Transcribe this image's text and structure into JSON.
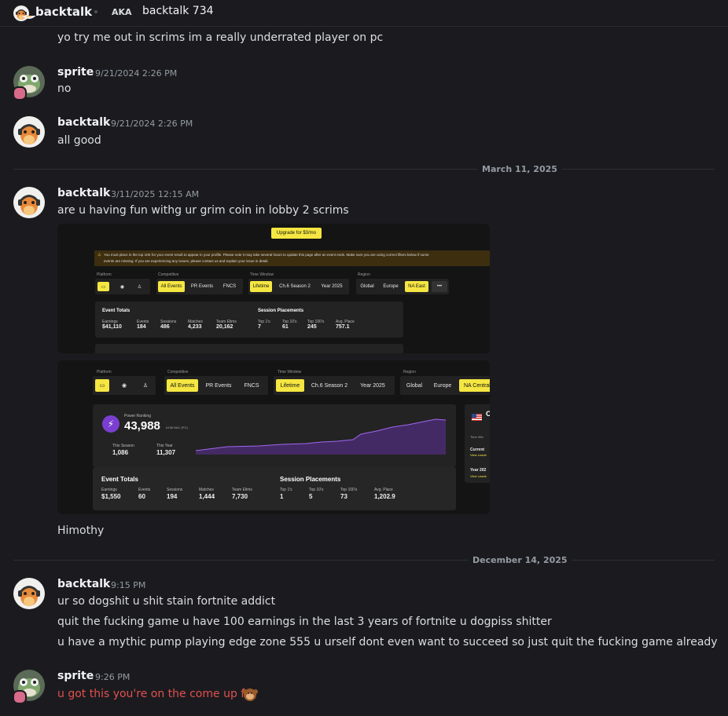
{
  "header": {
    "name": "backtalk",
    "aka_label": "AKA",
    "alias": "backtalk 734"
  },
  "messages": [
    {
      "text": "yo try me out in scrims im a really underrated player on pc"
    },
    {
      "author": "sprite",
      "time": "9/21/2024 2:26 PM",
      "text": "no"
    },
    {
      "author": "backtalk",
      "time": "9/21/2024 2:26 PM",
      "text": "all good"
    },
    {
      "author": "backtalk",
      "time": "3/11/2025 12:15 AM",
      "text": "are u having fun withg ur grim coin in lobby 2 scrims",
      "after_images": "Himothy"
    },
    {
      "author": "backtalk",
      "time": "9:15 PM",
      "lines": [
        "ur so dogshit u shit stain fortnite addict",
        "quit the fucking game u have 100 earnings in the last 3 years of fortnite u dogpiss shitter",
        "u have a mythic pump playing edge zone 555 u urself dont even want to succeed so just quit the fucking game already"
      ]
    },
    {
      "author": "sprite",
      "time": "9:26 PM",
      "text": "u got this you're on the come up fr",
      "emoji": "monkey-emoji",
      "text_color": "#e0504f"
    }
  ],
  "dividers": [
    "March 11, 2025",
    "December 14, 2025"
  ],
  "shot1": {
    "upgrade": "Upgrade for $3/mo",
    "warning": "You must place in the top 10K for your event result to appear in your profile. Please note it may take several hours to update this page after an event ends. Make sure you are using correct filters below if some",
    "warning2": "events are missing. If you are experiencing any issues, please contact us and explain your issue in detail.",
    "labels": {
      "platform": "Platform",
      "competitive": "Competitive",
      "time_window": "Time Window",
      "region": "Region"
    },
    "competitive": [
      "All Events",
      "PR Events",
      "FNCS"
    ],
    "time": [
      "Lifetime",
      "Ch.6 Season 2",
      "Year 2025"
    ],
    "region": [
      "Global",
      "Europe",
      "NA East",
      "•••"
    ],
    "event_totals": "Event Totals",
    "session_placements": "Session Placements",
    "stats": [
      {
        "label": "Earnings",
        "value": "$41,110"
      },
      {
        "label": "Events",
        "value": "184"
      },
      {
        "label": "Sessions",
        "value": "486"
      },
      {
        "label": "Matches",
        "value": "4,233"
      },
      {
        "label": "Team Elims",
        "value": "20,162"
      }
    ],
    "placements": [
      {
        "label": "Top 1's",
        "value": "7"
      },
      {
        "label": "Top 10's",
        "value": "61"
      },
      {
        "label": "Top 100's",
        "value": "245"
      },
      {
        "label": "Avg. Place",
        "value": "757.1"
      }
    ]
  },
  "shot2": {
    "labels": {
      "platform": "Platform",
      "competitive": "Competitive",
      "time_window": "Time Window",
      "region": "Region"
    },
    "competitive": [
      "All Events",
      "PR Events",
      "FNCS"
    ],
    "time": [
      "Lifetime",
      "Ch.6 Season 2",
      "Year 2025"
    ],
    "region": [
      "Global",
      "Europe",
      "NA Central"
    ],
    "power_ranking_label": "Power Ranking",
    "power_ranking": "43,988",
    "pr_rank": "#138 NAC (PC)",
    "this_season_label": "This Season",
    "this_season": "1,086",
    "this_year_label": "This Year",
    "this_year": "11,307",
    "event_totals": "Event Totals",
    "session_placements": "Session Placements",
    "stats": [
      {
        "label": "Earnings",
        "value": "$1,550"
      },
      {
        "label": "Events",
        "value": "60"
      },
      {
        "label": "Sessions",
        "value": "194"
      },
      {
        "label": "Matches",
        "value": "1,444"
      },
      {
        "label": "Team Elims",
        "value": "7,730"
      }
    ],
    "placements": [
      {
        "label": "Top 1's",
        "value": "1"
      },
      {
        "label": "Top 10's",
        "value": "5"
      },
      {
        "label": "Top 100's",
        "value": "73"
      },
      {
        "label": "Avg. Place",
        "value": "1,202.9"
      }
    ],
    "side": {
      "time_window": "Time Win",
      "current": "Current",
      "view1": "View Leade",
      "year": "Year 202",
      "view2": "View Leade"
    }
  },
  "colors": {
    "accent_yellow": "#f5e642",
    "chart_purple": "#8a4fd6",
    "red_text": "#e0504f"
  }
}
